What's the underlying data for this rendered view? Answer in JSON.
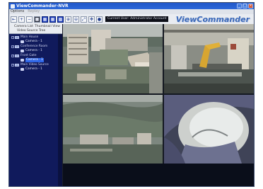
{
  "window": {
    "title": "ViewCommander-NVR"
  },
  "menu": {
    "items": [
      "Options",
      "Replay"
    ]
  },
  "toolbar": {
    "buttons": [
      "exit-icon",
      "camera-add-icon",
      "camera-remove-icon",
      "grid-1-icon",
      "grid-4-icon",
      "grid-9-icon",
      "grid-16-icon",
      "zoom-in-icon",
      "zoom-out-icon",
      "fit-icon",
      "ptz-icon",
      "record-icon"
    ],
    "account_text": "Current User: Administrator Account"
  },
  "brand": {
    "logo_text": "ViewCommander"
  },
  "sidebar": {
    "tabs": [
      "Camera List",
      "Thumbnail View",
      "Video Source Tree"
    ],
    "tree": [
      {
        "type": "group",
        "label": "Main House"
      },
      {
        "type": "camera",
        "label": "Camera - 1"
      },
      {
        "type": "group",
        "label": "Conference Room"
      },
      {
        "type": "camera",
        "label": "Camera - 1"
      },
      {
        "type": "group",
        "label": "Front Gate"
      },
      {
        "type": "camera",
        "label": "Camera - 1",
        "selected": true
      },
      {
        "type": "group",
        "label": "Main Video Source"
      },
      {
        "type": "camera",
        "label": "Camera - 1"
      }
    ]
  },
  "feeds": [
    {
      "name": "Campus buildings overview"
    },
    {
      "name": "Factory robot arm"
    },
    {
      "name": "Hillside city view"
    },
    {
      "name": "Dome close-up"
    }
  ],
  "colors": {
    "titlebar": "#1f56c9",
    "tree_bg": "#101a5c",
    "selected": "#2f66e6",
    "logo": "#3a68b8"
  }
}
